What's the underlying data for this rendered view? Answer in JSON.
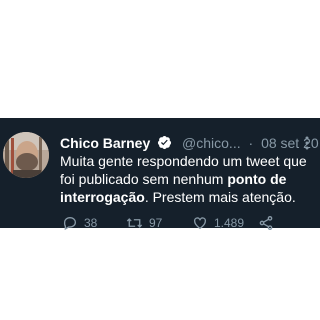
{
  "tweet": {
    "author_name": "Chico Barney",
    "handle": "@chico...",
    "separator": "·",
    "date": "08 set 20",
    "text_part1": "Muita gente respondendo um tweet que foi publicado sem nenhum ",
    "text_bold": "ponto de interrogação",
    "text_part2": ". Prestem mais atenção.",
    "replies": "38",
    "retweets": "97",
    "likes": "1.489"
  },
  "colors": {
    "page_background": "#ffffff",
    "tweet_background": "#15202b",
    "primary_text": "#ffffff",
    "secondary_text": "#8899a6",
    "verified_badge": "#ffffff"
  },
  "icons": {
    "verified": "verified-badge-icon",
    "more": "more-options-icon",
    "reply": "reply-icon",
    "retweet": "retweet-icon",
    "like": "heart-icon",
    "share": "share-icon"
  }
}
